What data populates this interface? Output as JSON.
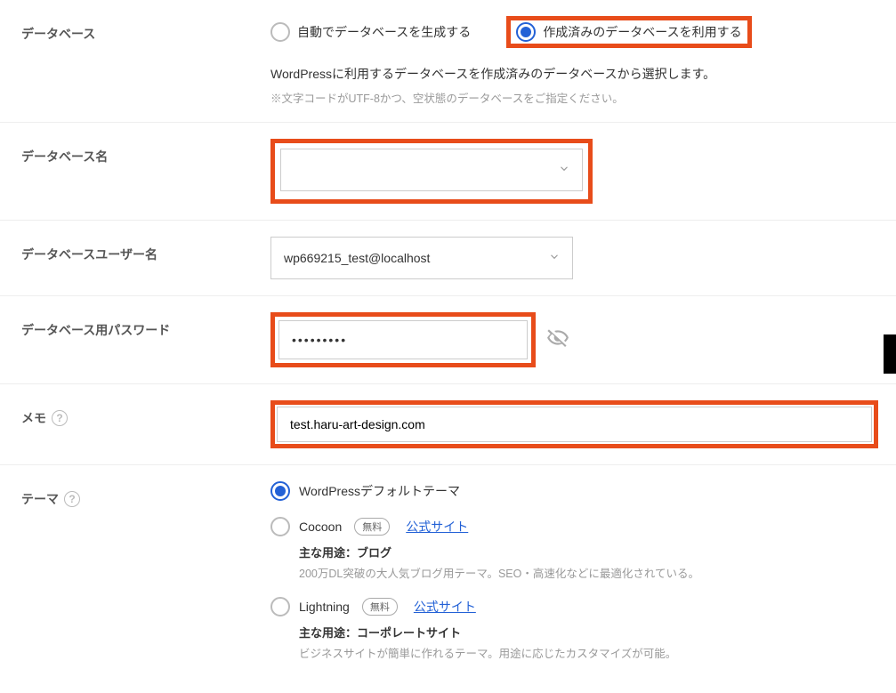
{
  "labels": {
    "database": "データベース",
    "database_name": "データベース名",
    "database_user": "データベースユーザー名",
    "database_password": "データベース用パスワード",
    "memo": "メモ",
    "theme": "テーマ"
  },
  "database": {
    "radio_auto": "自動でデータベースを生成する",
    "radio_existing": "作成済みのデータベースを利用する",
    "selected": "existing",
    "desc": "WordPressに利用するデータベースを作成済みのデータベースから選択します。",
    "sub_desc": "※文字コードがUTF-8かつ、空状態のデータベースをご指定ください。"
  },
  "db_name": "",
  "db_user": "wp669215_test@localhost",
  "db_password": "•••••••••",
  "memo_value": "test.haru-art-design.com",
  "theme": {
    "default_label": "WordPressデフォルトテーマ",
    "selected": "default",
    "options": [
      {
        "name": "Cocoon",
        "badge": "無料",
        "link": "公式サイト",
        "heading": "主な用途：ブログ",
        "desc": "200万DL突破の大人気ブログ用テーマ。SEO・高速化などに最適化されている。"
      },
      {
        "name": "Lightning",
        "badge": "無料",
        "link": "公式サイト",
        "heading": "主な用途：コーポレートサイト",
        "desc": "ビジネスサイトが簡単に作れるテーマ。用途に応じたカスタマイズが可能。"
      }
    ]
  }
}
